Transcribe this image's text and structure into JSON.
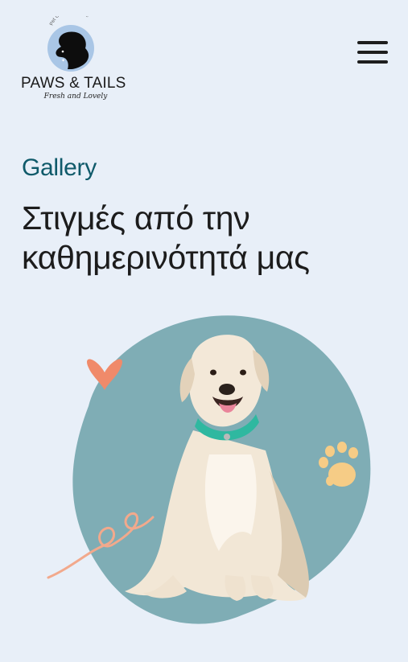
{
  "header": {
    "logo": {
      "brand_name": "PAWS & TAILS",
      "tagline": "Fresh and Lovely",
      "arc_text": "Pet Grooming Store"
    },
    "menu_icon": "hamburger-menu-icon"
  },
  "main": {
    "eyebrow": "Gallery",
    "heading": "Στιγμές από την καθημερινότητά μας"
  },
  "colors": {
    "background": "#e8eff8",
    "blob": "#7fadb5",
    "eyebrow": "#0f5a6a",
    "heart": "#f08a6a",
    "paw": "#f6cc86",
    "squiggle": "#f2a98c",
    "collar": "#2fb8a0"
  },
  "decorations": [
    "heart-icon",
    "paw-icon",
    "squiggle-line",
    "dog-photo"
  ]
}
